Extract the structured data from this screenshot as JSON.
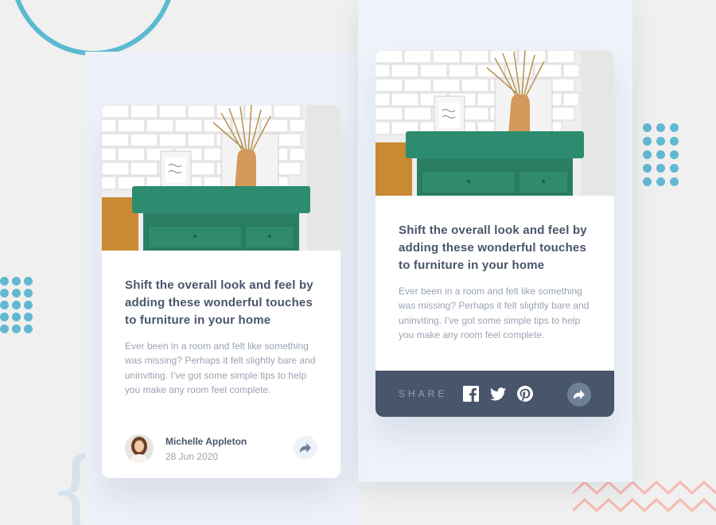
{
  "cards": [
    {
      "title": "Shift the overall look and feel by adding these wonderful touches to furniture in your home",
      "description": "Ever been in a room and felt like something was missing? Perhaps it felt slightly bare and uninviting. I’ve got some simple tips to help you make any room feel complete.",
      "author": {
        "name": "Michelle Appleton",
        "date": "28 Jun 2020"
      },
      "share_icon": "share-icon"
    },
    {
      "title": "Shift the overall look and feel by adding these wonderful touches to furniture in your home",
      "description": "Ever been in a room and felt like something was missing? Perhaps it felt slightly bare and uninviting. I’ve got some simple tips to help you make any room feel complete.",
      "share_bar": {
        "label": "SHARE",
        "icons": [
          "facebook-icon",
          "twitter-icon",
          "pinterest-icon"
        ]
      },
      "share_icon": "share-icon"
    }
  ],
  "colors": {
    "accent_cyan": "#5bbad0",
    "dark_blue": "#48556a",
    "grayish_blue": "#9aa3b2",
    "light_grayish_blue": "#ecf2f8",
    "teal_dresser": "#2f8a6e",
    "zigzag": "#f6b8b0"
  }
}
